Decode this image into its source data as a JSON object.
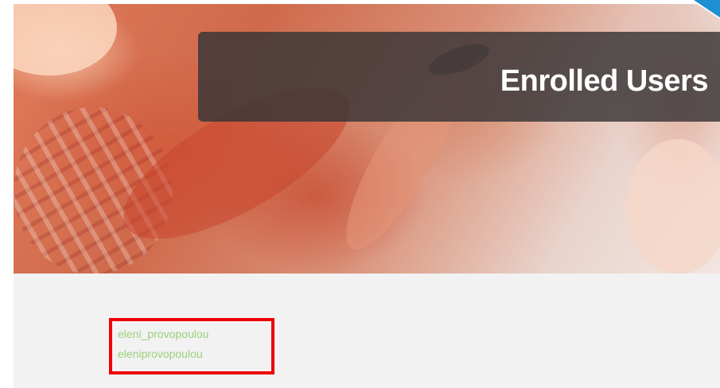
{
  "header": {
    "title": "Enrolled Users"
  },
  "users": [
    {
      "name": "eleni_provopoulou"
    },
    {
      "name": "eleniprovopoulou"
    }
  ],
  "colors": {
    "title_overlay": "#37343a",
    "content_background": "#f2f2f2",
    "user_link": "#9ad17c",
    "highlight_border": "#ee0000",
    "corner_accent": "#1e8fd0"
  }
}
